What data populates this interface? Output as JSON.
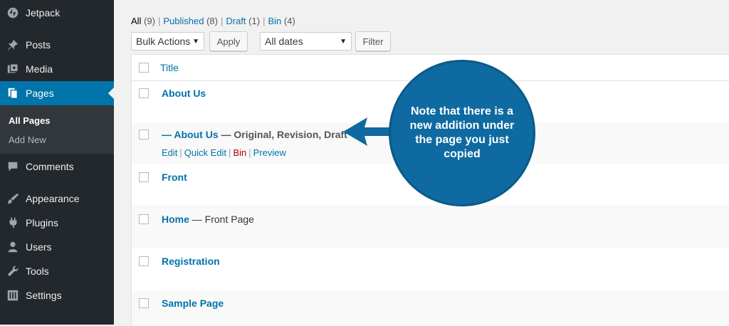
{
  "sidebar": {
    "items": [
      {
        "label": "Jetpack",
        "icon": "jetpack-icon"
      },
      {
        "label": "Posts",
        "icon": "pin-icon"
      },
      {
        "label": "Media",
        "icon": "media-icon"
      },
      {
        "label": "Pages",
        "icon": "pages-icon"
      },
      {
        "label": "Comments",
        "icon": "comment-icon"
      },
      {
        "label": "Appearance",
        "icon": "brush-icon"
      },
      {
        "label": "Plugins",
        "icon": "plugin-icon"
      },
      {
        "label": "Users",
        "icon": "user-icon"
      },
      {
        "label": "Tools",
        "icon": "wrench-icon"
      },
      {
        "label": "Settings",
        "icon": "settings-icon"
      }
    ],
    "submenu": [
      "All Pages",
      "Add New"
    ]
  },
  "filters": {
    "all": "All",
    "all_count": "(9)",
    "published": "Published",
    "published_count": "(8)",
    "draft": "Draft",
    "draft_count": "(1)",
    "bin": "Bin",
    "bin_count": "(4)",
    "sep": "|"
  },
  "controls": {
    "bulk": "Bulk Actions",
    "apply": "Apply",
    "dates": "All dates",
    "filter": "Filter"
  },
  "table": {
    "header": "Title",
    "rows": [
      {
        "title": "About Us",
        "state": ""
      },
      {
        "title": "— About Us",
        "state": " — Original, Revision, Draft"
      },
      {
        "title": "Front",
        "state": ""
      },
      {
        "title": "Home",
        "state": " — Front Page"
      },
      {
        "title": "Registration",
        "state": ""
      },
      {
        "title": "Sample Page",
        "state": ""
      }
    ],
    "row_actions": {
      "edit": "Edit",
      "quick_edit": "Quick Edit",
      "bin": "Bin",
      "preview": "Preview",
      "sep": "|"
    }
  },
  "callout": {
    "text": "Note that there is a new addition under the page you just copied",
    "color": "#0e6aa1"
  }
}
